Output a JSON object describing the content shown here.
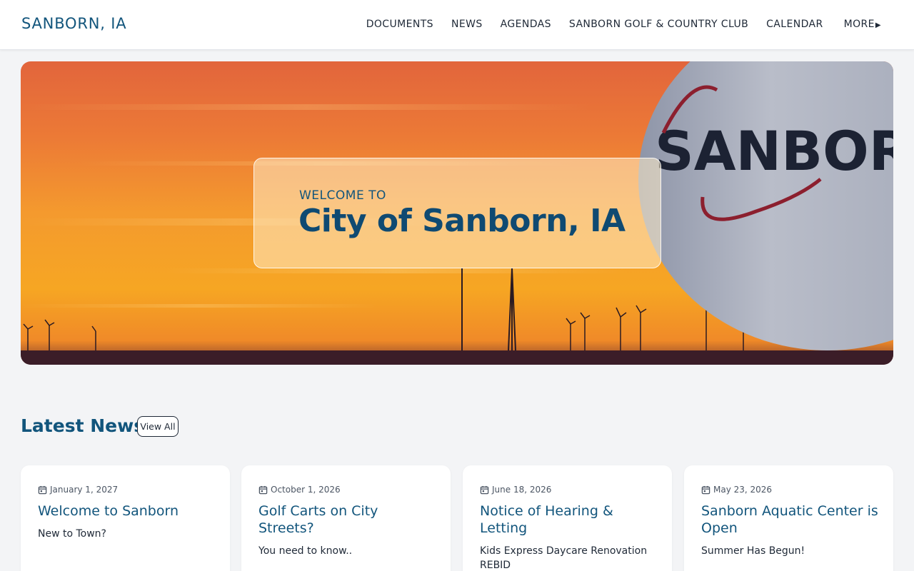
{
  "site": {
    "name": "SANBORN, IA"
  },
  "nav": {
    "items": [
      {
        "label": "DOCUMENTS"
      },
      {
        "label": "NEWS"
      },
      {
        "label": "AGENDAS"
      },
      {
        "label": "SANBORN GOLF & COUNTRY CLUB"
      },
      {
        "label": "CALENDAR"
      }
    ],
    "more_label": "MORE",
    "more_icon": "caret-right-icon"
  },
  "hero": {
    "welcome_label": "WELCOME TO",
    "title": "City of Sanborn, IA",
    "tower_lettering": "SANBORN",
    "colors": {
      "sky_top": "#e8663a",
      "sky_mid": "#f59b2e",
      "sky_low": "#f7a825",
      "ground": "#3b1d28"
    }
  },
  "news": {
    "heading": "Latest News",
    "view_all_label": "View All",
    "items": [
      {
        "date": "January 1, 2027",
        "title": "Welcome to Sanborn",
        "summary": "New to Town?"
      },
      {
        "date": "October 1, 2026",
        "title": "Golf Carts on City Streets?",
        "summary": "You need to know.."
      },
      {
        "date": "June 18, 2026",
        "title": "Notice of Hearing & Letting",
        "summary": "Kids Express Daycare Renovation REBID"
      },
      {
        "date": "May 23, 2026",
        "title": "Sanborn Aquatic Center is Open",
        "summary": "Summer Has Begun!"
      }
    ]
  },
  "theme": {
    "accent": "#12557c",
    "page_bg": "#f3f4f6",
    "card_bg": "#ffffff"
  }
}
